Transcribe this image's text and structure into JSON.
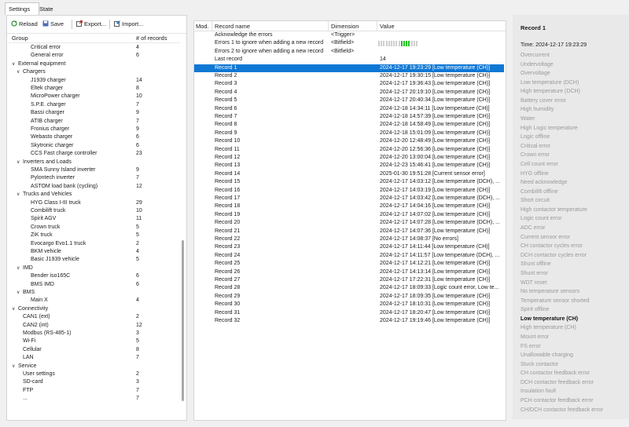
{
  "tabs": {
    "settings": "Settings",
    "state": "State"
  },
  "toolbar": {
    "reload": "Reload",
    "save": "Save",
    "export": "Export...",
    "import": "Import..."
  },
  "tree": {
    "col_group": "Group",
    "col_count": "# of records",
    "rows": [
      {
        "label": "Critical error",
        "count": "4",
        "depth": 2,
        "tw": ""
      },
      {
        "label": "General error",
        "count": "6",
        "depth": 2,
        "tw": ""
      },
      {
        "label": "External equipment",
        "count": "",
        "depth": 0,
        "tw": "v"
      },
      {
        "label": "Chargers",
        "count": "",
        "depth": 1,
        "tw": "v"
      },
      {
        "label": "J1939 charger",
        "count": "14",
        "depth": 2,
        "tw": ""
      },
      {
        "label": "Eltek charger",
        "count": "8",
        "depth": 2,
        "tw": ""
      },
      {
        "label": "MicroPower charger",
        "count": "10",
        "depth": 2,
        "tw": ""
      },
      {
        "label": "S.P.E. charger",
        "count": "7",
        "depth": 2,
        "tw": ""
      },
      {
        "label": "Bassi charger",
        "count": "9",
        "depth": 2,
        "tw": ""
      },
      {
        "label": "ATIB charger",
        "count": "7",
        "depth": 2,
        "tw": ""
      },
      {
        "label": "Fronius charger",
        "count": "9",
        "depth": 2,
        "tw": ""
      },
      {
        "label": "Webasto charger",
        "count": "6",
        "depth": 2,
        "tw": ""
      },
      {
        "label": "Skytronic charger",
        "count": "6",
        "depth": 2,
        "tw": ""
      },
      {
        "label": "CCS Fast charge controller",
        "count": "23",
        "depth": 2,
        "tw": ""
      },
      {
        "label": "Inverters and Loads",
        "count": "",
        "depth": 1,
        "tw": "v"
      },
      {
        "label": "SMA Sunny Island inverter",
        "count": "9",
        "depth": 2,
        "tw": ""
      },
      {
        "label": "Pylontech inverter",
        "count": "7",
        "depth": 2,
        "tw": ""
      },
      {
        "label": "ASTOM load bank (cycling)",
        "count": "12",
        "depth": 2,
        "tw": ""
      },
      {
        "label": "Trucks and Vehicles",
        "count": "",
        "depth": 1,
        "tw": "v"
      },
      {
        "label": "HYG Class I-III truck",
        "count": "29",
        "depth": 2,
        "tw": ""
      },
      {
        "label": "Combilift truck",
        "count": "10",
        "depth": 2,
        "tw": ""
      },
      {
        "label": "Spirit AGV",
        "count": "11",
        "depth": 2,
        "tw": ""
      },
      {
        "label": "Crown truck",
        "count": "5",
        "depth": 2,
        "tw": ""
      },
      {
        "label": "ZiK truck",
        "count": "5",
        "depth": 2,
        "tw": ""
      },
      {
        "label": "Evocargo Evo1.1 truck",
        "count": "2",
        "depth": 2,
        "tw": ""
      },
      {
        "label": "BKM vehicle",
        "count": "4",
        "depth": 2,
        "tw": ""
      },
      {
        "label": "Basic J1939 vehicle",
        "count": "5",
        "depth": 2,
        "tw": ""
      },
      {
        "label": "IMD",
        "count": "",
        "depth": 1,
        "tw": "v"
      },
      {
        "label": "Bender iso165C",
        "count": "6",
        "depth": 2,
        "tw": ""
      },
      {
        "label": "BMS IMD",
        "count": "6",
        "depth": 2,
        "tw": ""
      },
      {
        "label": "BMS",
        "count": "",
        "depth": 1,
        "tw": "v"
      },
      {
        "label": "Main X",
        "count": "4",
        "depth": 2,
        "tw": ""
      },
      {
        "label": "Connectivity",
        "count": "",
        "depth": 0,
        "tw": "v"
      },
      {
        "label": "CAN1 (ext)",
        "count": "2",
        "depth": 1,
        "tw": ""
      },
      {
        "label": "CAN2 (int)",
        "count": "12",
        "depth": 1,
        "tw": ""
      },
      {
        "label": "Modbus (RS-485-1)",
        "count": "3",
        "depth": 1,
        "tw": ""
      },
      {
        "label": "Wi-Fi",
        "count": "5",
        "depth": 1,
        "tw": ""
      },
      {
        "label": "Cellular",
        "count": "8",
        "depth": 1,
        "tw": ""
      },
      {
        "label": "LAN",
        "count": "7",
        "depth": 1,
        "tw": ""
      },
      {
        "label": "Service",
        "count": "",
        "depth": 0,
        "tw": "v"
      },
      {
        "label": "User settings",
        "count": "2",
        "depth": 1,
        "tw": ""
      },
      {
        "label": "SD-card",
        "count": "3",
        "depth": 1,
        "tw": ""
      },
      {
        "label": "FTP",
        "count": "7",
        "depth": 1,
        "tw": ""
      },
      {
        "label": "...",
        "count": "7",
        "depth": 1,
        "tw": ""
      }
    ]
  },
  "grid": {
    "col_mod": "Mod.",
    "col_name": "Record name",
    "col_dim": "Dimension",
    "col_value": "Value",
    "props": [
      {
        "name": "Acknowledge the errors",
        "dim": "<Trigger>",
        "value": ""
      },
      {
        "name": "Errors 1 to ignore when adding a new record",
        "dim": "<Bitfield>",
        "value": ""
      },
      {
        "name": "Errors 2 to ignore when adding a new record",
        "dim": "<Bitfield>",
        "value": ""
      },
      {
        "name": "Last record",
        "dim": "",
        "value": "14"
      }
    ],
    "bitfield_on": [
      9,
      10,
      11,
      12
    ],
    "records": [
      {
        "name": "Record 1",
        "value": "2024-12-17 19:23:29 [Low temperature (CH)]",
        "selected": true
      },
      {
        "name": "Record 2",
        "value": "2024-12-17 19:30:15 [Low temperature (CH)]"
      },
      {
        "name": "Record 3",
        "value": "2024-12-17 19:36:43 [Low temperature (CH)]"
      },
      {
        "name": "Record 4",
        "value": "2024-12-17 20:19:10 [Low temperature (CH)]"
      },
      {
        "name": "Record 5",
        "value": "2024-12-17 20:40:34 [Low temperature (CH)]"
      },
      {
        "name": "Record 6",
        "value": "2024-12-18 14:34:11 [Low temperature (CH)]"
      },
      {
        "name": "Record 7",
        "value": "2024-12-18 14:57:39 [Low temperature (CH)]"
      },
      {
        "name": "Record 8",
        "value": "2024-12-18 14:58:49 [Low temperature (CH)]"
      },
      {
        "name": "Record 9",
        "value": "2024-12-18 15:01:09 [Low temperature (CH)]"
      },
      {
        "name": "Record 10",
        "value": "2024-12-20 12:48:49 [Low temperature (CH)]"
      },
      {
        "name": "Record 11",
        "value": "2024-12-20 12:56:36 [Low temperature (CH)]"
      },
      {
        "name": "Record 12",
        "value": "2024-12-20 13:00:04 [Low temperature (CH)]"
      },
      {
        "name": "Record 13",
        "value": "2024-12-23 15:46:41 [Low temperature (CH)]"
      },
      {
        "name": "Record 14",
        "value": "2025-01-30 19:51:28 [Current sensor error]"
      },
      {
        "name": "Record 15",
        "value": "2024-12-17 14:03:12 [Low temperature (DCH), ..."
      },
      {
        "name": "Record 16",
        "value": "2024-12-17 14:03:19 [Low temperature (CH)]"
      },
      {
        "name": "Record 17",
        "value": "2024-12-17 14:03:42 [Low temperature (DCH), ..."
      },
      {
        "name": "Record 18",
        "value": "2024-12-17 14:04:16 [Low temperature (CH)]"
      },
      {
        "name": "Record 19",
        "value": "2024-12-17 14:07:02 [Low temperature (CH)]"
      },
      {
        "name": "Record 20",
        "value": "2024-12-17 14:07:28 [Low temperature (DCH), ..."
      },
      {
        "name": "Record 21",
        "value": "2024-12-17 14:07:36 [Low temperature (CH)]"
      },
      {
        "name": "Record 22",
        "value": "2024-12-17 14:08:37 [No errors]"
      },
      {
        "name": "Record 23",
        "value": "2024-12-17 14:11:44 [Low temperature (CH)]"
      },
      {
        "name": "Record 24",
        "value": "2024-12-17 14:11:57 [Low temperature (DCH), ..."
      },
      {
        "name": "Record 25",
        "value": "2024-12-17 14:12:21 [Low temperature (CH)]"
      },
      {
        "name": "Record 26",
        "value": "2024-12-17 14:13:14 [Low temperature (CH)]"
      },
      {
        "name": "Record 27",
        "value": "2024-12-17 17:22:31 [Low temperature (CH)]"
      },
      {
        "name": "Record 28",
        "value": "2024-12-17 18:09:33 [Logic count error, Low te..."
      },
      {
        "name": "Record 29",
        "value": "2024-12-17 18:09:35 [Low temperature (CH)]"
      },
      {
        "name": "Record 30",
        "value": "2024-12-17 18:10:31 [Low temperature (CH)]"
      },
      {
        "name": "Record 31",
        "value": "2024-12-17 18:20:47 [Low temperature (CH)]"
      },
      {
        "name": "Record 32",
        "value": "2024-12-17 19:19:46 [Low temperature (CH)]"
      }
    ]
  },
  "detail": {
    "title": "Record 1",
    "time": "Time: 2024-12-17 19:23:29",
    "errors": [
      {
        "label": "Overcurrent",
        "active": false
      },
      {
        "label": "Undervoltage",
        "active": false
      },
      {
        "label": "Overvoltage",
        "active": false
      },
      {
        "label": "Low temperature (DCH)",
        "active": false
      },
      {
        "label": "High temperature (DCH)",
        "active": false
      },
      {
        "label": "Battery cover error",
        "active": false
      },
      {
        "label": "High humidity",
        "active": false
      },
      {
        "label": "Water",
        "active": false
      },
      {
        "label": "High Logic temperature",
        "active": false
      },
      {
        "label": "Logic offline",
        "active": false
      },
      {
        "label": "Critical error",
        "active": false
      },
      {
        "label": "Crown error",
        "active": false
      },
      {
        "label": "Cell count error",
        "active": false
      },
      {
        "label": "HYG offline",
        "active": false
      },
      {
        "label": "Need acknowledge",
        "active": false
      },
      {
        "label": "Combilift offline",
        "active": false
      },
      {
        "label": "Short circuit",
        "active": false
      },
      {
        "label": "High contactor temperature",
        "active": false
      },
      {
        "label": "Logic count error",
        "active": false
      },
      {
        "label": "ADC error",
        "active": false
      },
      {
        "label": "Current sensor error",
        "active": false
      },
      {
        "label": "CH contactor cycles error",
        "active": false
      },
      {
        "label": "DCH contactor cycles error",
        "active": false
      },
      {
        "label": "Shunt offline",
        "active": false
      },
      {
        "label": "Shunt error",
        "active": false
      },
      {
        "label": "WDT reset",
        "active": false
      },
      {
        "label": "No temperature sensors",
        "active": false
      },
      {
        "label": "Temperature sensor shorted",
        "active": false
      },
      {
        "label": "Spirit offline",
        "active": false
      },
      {
        "label": "Low temperature (CH)",
        "active": true
      },
      {
        "label": "High temperature (CH)",
        "active": false
      },
      {
        "label": "Mount error",
        "active": false
      },
      {
        "label": "FS error",
        "active": false
      },
      {
        "label": "Unallowable charging",
        "active": false
      },
      {
        "label": "Stuck contactor",
        "active": false
      },
      {
        "label": "CH contactor feedback error",
        "active": false
      },
      {
        "label": "DCH contactor feedback error",
        "active": false
      },
      {
        "label": "Insulation fault",
        "active": false
      },
      {
        "label": "PCH contactor feedback error",
        "active": false
      },
      {
        "label": "CH/DCH contactor feedback error",
        "active": false
      }
    ]
  },
  "colors": {
    "selection": "#0f78d4",
    "bit_on": "#22c322",
    "bit_off": "#cfcfcf"
  }
}
